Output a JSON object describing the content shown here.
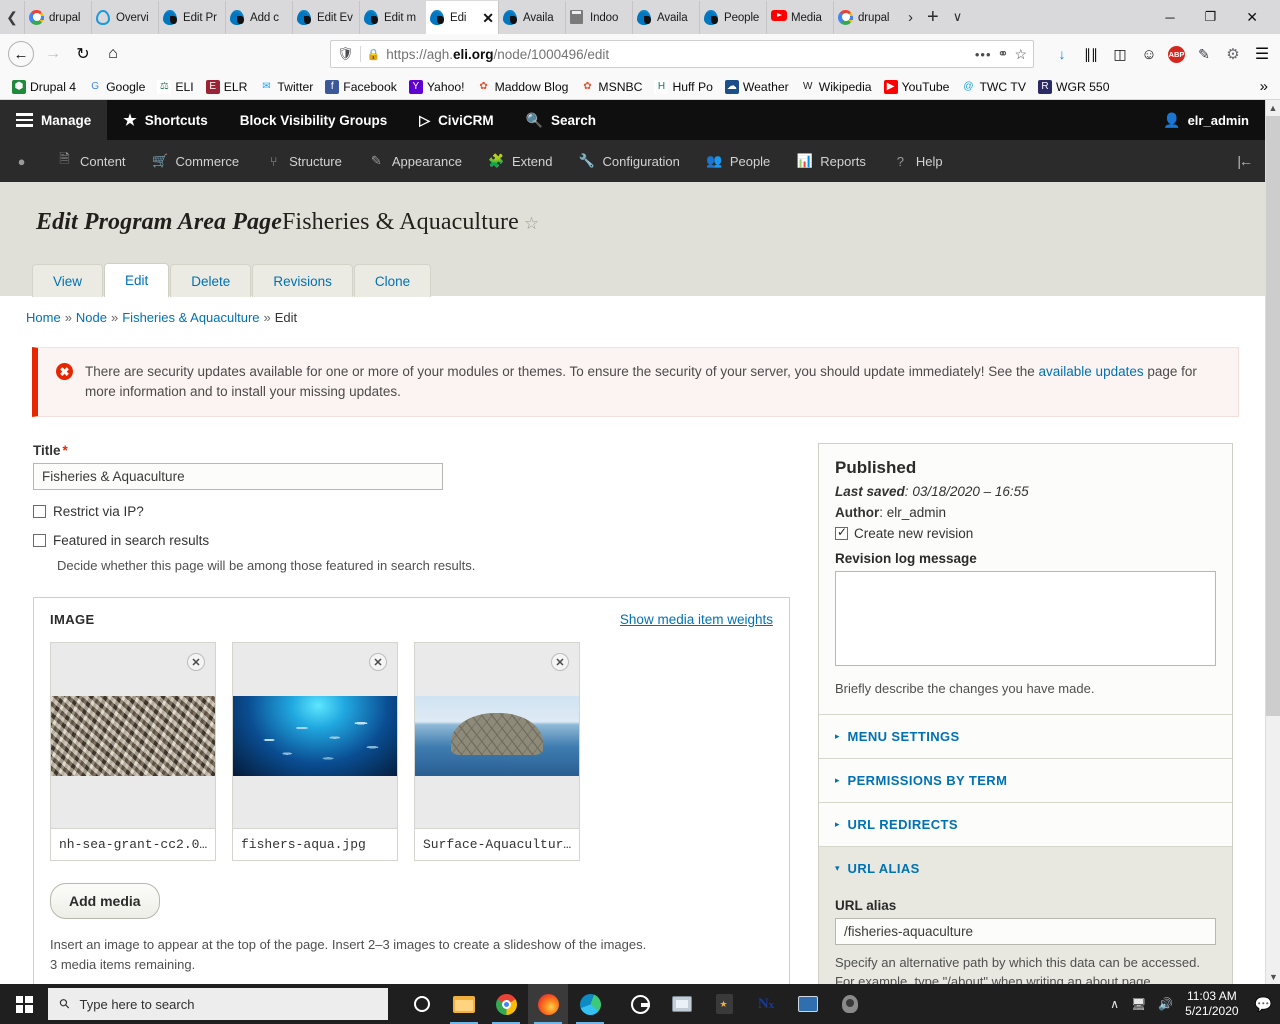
{
  "browser": {
    "tabs": [
      {
        "label": "drupal",
        "icon": "google-favicon",
        "active": false
      },
      {
        "label": "Overvi",
        "icon": "drupal-outline-favicon",
        "active": false
      },
      {
        "label": "Edit Pr",
        "icon": "drupal-favicon",
        "active": false
      },
      {
        "label": "Add c",
        "icon": "drupal-favicon",
        "active": false
      },
      {
        "label": "Edit Ev",
        "icon": "drupal-favicon",
        "active": false
      },
      {
        "label": "Edit m",
        "icon": "drupal-favicon",
        "active": false
      },
      {
        "label": "Edi",
        "icon": "drupal-favicon",
        "active": true
      },
      {
        "label": "Availa",
        "icon": "drupal-favicon",
        "active": false
      },
      {
        "label": "Indoo",
        "icon": "doc-favicon",
        "active": false
      },
      {
        "label": "Availa",
        "icon": "drupal-favicon",
        "active": false
      },
      {
        "label": "People",
        "icon": "drupal-favicon",
        "active": false
      },
      {
        "label": "Media",
        "icon": "youtube-favicon",
        "active": false
      },
      {
        "label": "drupal",
        "icon": "google-favicon",
        "active": false
      }
    ],
    "tab_close_label": "✕",
    "tab_list_chevron": "›",
    "new_tab_label": "+",
    "tab_dropdown_label": "∨",
    "window_minimize": "─",
    "window_restore": "❐",
    "window_close": "✕",
    "nav": {
      "back": "←",
      "forward": "→",
      "reload": "↻",
      "home": "⌂"
    },
    "url": {
      "prefix": "https://agh.",
      "domain": "eli.org",
      "path": "/node/1000496/edit",
      "shield_icon": "shield-icon",
      "lock_icon": "lock-icon",
      "page_actions": "•••",
      "pocket": "pocket-icon",
      "bookmark_star": "☆"
    },
    "toolbar_icons": [
      "download-icon",
      "library-icon",
      "sidebar-icon",
      "account-icon",
      "adblock-icon",
      "eyedropper-icon",
      "gear-icon",
      "menu-icon"
    ],
    "adblock_label": "ABP",
    "bookmarks": [
      {
        "label": "Drupal 4",
        "icon": "drupal-bookmark-icon"
      },
      {
        "label": "Google",
        "icon": "google-bookmark-icon"
      },
      {
        "label": "ELI",
        "icon": "eli-bookmark-icon"
      },
      {
        "label": "ELR",
        "icon": "elr-bookmark-icon"
      },
      {
        "label": "Twitter",
        "icon": "twitter-bookmark-icon"
      },
      {
        "label": "Facebook",
        "icon": "facebook-bookmark-icon"
      },
      {
        "label": "Yahoo!",
        "icon": "yahoo-bookmark-icon"
      },
      {
        "label": "Maddow Blog",
        "icon": "msnbc-bookmark-icon"
      },
      {
        "label": "MSNBC",
        "icon": "msnbc-bookmark-icon"
      },
      {
        "label": "Huff Po",
        "icon": "huffpo-bookmark-icon"
      },
      {
        "label": "Weather",
        "icon": "weather-bookmark-icon"
      },
      {
        "label": "Wikipedia",
        "icon": "wikipedia-bookmark-icon"
      },
      {
        "label": "YouTube",
        "icon": "youtube-bookmark-icon"
      },
      {
        "label": "TWC TV",
        "icon": "twctv-bookmark-icon"
      },
      {
        "label": "WGR 550",
        "icon": "wgr-bookmark-icon"
      }
    ],
    "bookmarks_overflow": "»"
  },
  "drupal_toolbar": {
    "manage": "Manage",
    "shortcuts": "Shortcuts",
    "block_visibility_groups": "Block Visibility Groups",
    "civicrm": "CiviCRM",
    "search": "Search",
    "user": "elr_admin",
    "tray": [
      {
        "label": "",
        "icon": "drupal-drop-icon"
      },
      {
        "label": "Content",
        "icon": "content-icon"
      },
      {
        "label": "Commerce",
        "icon": "commerce-icon"
      },
      {
        "label": "Structure",
        "icon": "structure-icon"
      },
      {
        "label": "Appearance",
        "icon": "appearance-icon"
      },
      {
        "label": "Extend",
        "icon": "extend-icon"
      },
      {
        "label": "Configuration",
        "icon": "configuration-icon"
      },
      {
        "label": "People",
        "icon": "people-icon"
      },
      {
        "label": "Reports",
        "icon": "reports-icon"
      },
      {
        "label": "Help",
        "icon": "help-icon"
      }
    ],
    "collapse_label": "|←"
  },
  "page": {
    "title_prefix": "Edit Program Area Page",
    "title_name": "Fisheries & Aquaculture",
    "title_star": "☆",
    "tabs": [
      {
        "label": "View",
        "active": false
      },
      {
        "label": "Edit",
        "active": true
      },
      {
        "label": "Delete",
        "active": false
      },
      {
        "label": "Revisions",
        "active": false
      },
      {
        "label": "Clone",
        "active": false
      }
    ],
    "breadcrumb": {
      "home": "Home",
      "node": "Node",
      "item": "Fisheries & Aquaculture",
      "current": "Edit",
      "separator": "»"
    },
    "alert": {
      "icon": "error-icon",
      "text_before": "There are security updates available for one or more of your modules or themes. To ensure the security of your server, you should update immediately! See the ",
      "link": "available updates",
      "text_after": " page for more information and to install your missing updates."
    },
    "form": {
      "title_label": "Title",
      "title_required": "*",
      "title_value": "Fisheries & Aquaculture",
      "restrict_ip_label": "Restrict via IP?",
      "restrict_ip_checked": false,
      "featured_label": "Featured in search results",
      "featured_checked": false,
      "featured_desc": "Decide whether this page will be among those featured in search results."
    },
    "image_field": {
      "legend": "IMAGE",
      "show_weights": "Show media item weights",
      "remove_icon": "✕",
      "items": [
        {
          "name": "nh-sea-grant-cc2.0…",
          "thumb": "mussels-photo"
        },
        {
          "name": "fishers-aqua.jpg",
          "thumb": "school-of-fish-photo"
        },
        {
          "name": "Surface-Aquacultur…",
          "thumb": "aquaculture-cage-photo"
        }
      ],
      "add_media_label": "Add media",
      "description_line1": "Insert an image to appear at the top of the page. Insert 2–3 images to create a slideshow of the images.",
      "description_line2": "3 media items remaining."
    },
    "sidebar": {
      "status": "Published",
      "last_saved_label": "Last saved",
      "last_saved_value": "03/18/2020 – 16:55",
      "author_label": "Author",
      "author_value": "elr_admin",
      "create_revision_label": "Create new revision",
      "create_revision_checked": true,
      "revision_log_label": "Revision log message",
      "revision_log_value": "",
      "revision_log_help": "Briefly describe the changes you have made.",
      "sections": [
        {
          "label": "MENU SETTINGS",
          "open": false,
          "marker": "▸"
        },
        {
          "label": "PERMISSIONS BY TERM",
          "open": false,
          "marker": "▸"
        },
        {
          "label": "URL REDIRECTS",
          "open": false,
          "marker": "▸"
        },
        {
          "label": "URL ALIAS",
          "open": true,
          "marker": "▾"
        }
      ],
      "url_alias_label": "URL alias",
      "url_alias_value": "/fisheries-aquaculture",
      "url_alias_help_line1": "Specify an alternative path by which this data can be accessed.",
      "url_alias_help_line2": "For example, type \"/about\" when writing an about page."
    }
  },
  "taskbar": {
    "start_icon": "windows-start-icon",
    "search_placeholder": "Type here to search",
    "search_icon": "search-icon",
    "cortana_icon": "cortana-icon",
    "apps": [
      {
        "icon": "file-explorer-icon",
        "active": false,
        "running": true
      },
      {
        "icon": "chrome-icon",
        "active": false,
        "running": true
      },
      {
        "icon": "firefox-icon",
        "active": true,
        "running": true
      },
      {
        "icon": "edge-icon",
        "active": false,
        "running": true
      },
      {
        "icon": "citrix-icon",
        "active": false,
        "running": false
      },
      {
        "icon": "monitor-app-icon",
        "active": false,
        "running": false
      },
      {
        "icon": "reader-app-icon",
        "active": false,
        "running": false
      },
      {
        "icon": "nx-app-icon",
        "active": false,
        "running": false
      },
      {
        "icon": "remote-desktop-icon",
        "active": false,
        "running": false
      },
      {
        "icon": "webcam-icon",
        "active": false,
        "running": false
      }
    ],
    "tray_chevron": "∧",
    "network_icon": "network-icon",
    "volume_icon": "volume-icon",
    "time": "11:03 AM",
    "date": "5/21/2020",
    "action_center_icon": "notification-icon"
  }
}
